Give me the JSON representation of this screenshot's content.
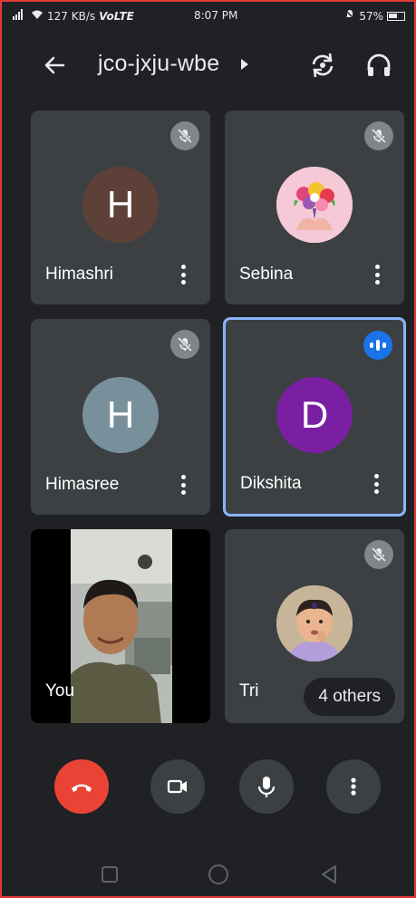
{
  "status_bar": {
    "network_speed": "127 KB/s",
    "network_type": "VoLTE",
    "time": "8:07 PM",
    "battery": "57%"
  },
  "header": {
    "meeting_code": "jco-jxju-wbe"
  },
  "participants": [
    {
      "name": "Himashri",
      "initial": "H",
      "avatar_color": "#5d4037",
      "mic_muted": true
    },
    {
      "name": "Sebina",
      "initial": "",
      "avatar_type": "photo",
      "mic_muted": true
    },
    {
      "name": "Himasree",
      "initial": "H",
      "avatar_color": "#78909c",
      "mic_muted": true
    },
    {
      "name": "Dikshita",
      "initial": "D",
      "avatar_color": "#7b1fa2",
      "speaking": true
    },
    {
      "name": "You",
      "video_on": true
    },
    {
      "name": "Tri",
      "avatar_type": "photo",
      "mic_muted": true
    }
  ],
  "others_label": "4 others",
  "colors": {
    "background": "#202124",
    "tile": "#3c4043",
    "end_call": "#ea4335",
    "speaking_border": "#8ab4f8",
    "speaking_badge": "#1a73e8"
  },
  "controls": {
    "items": [
      "end-call",
      "camera",
      "microphone",
      "more-options"
    ]
  }
}
